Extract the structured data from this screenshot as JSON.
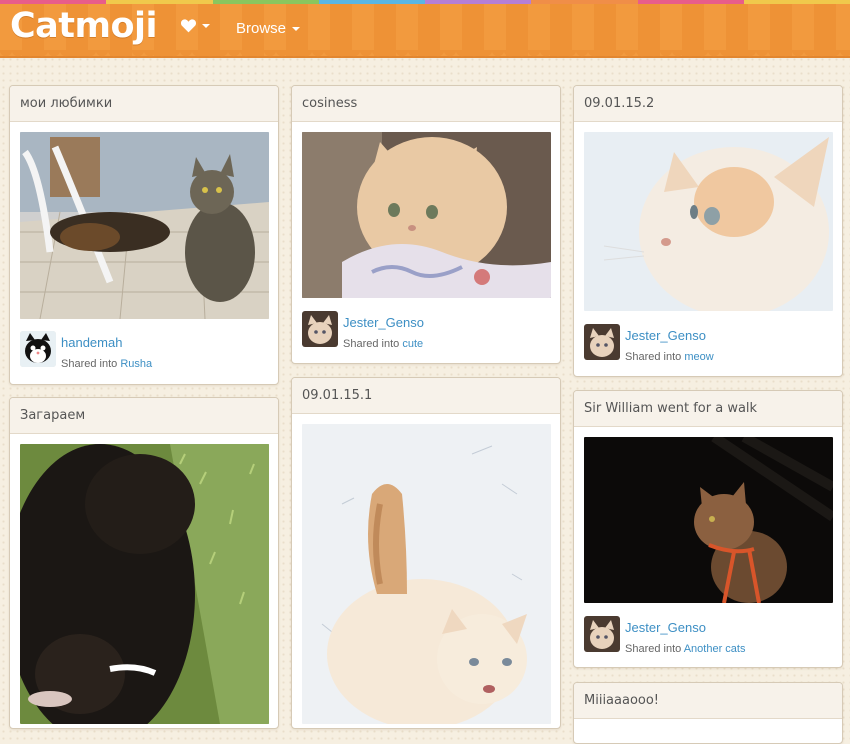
{
  "app": {
    "logo": "Catmoji",
    "nav": {
      "browse_label": "Browse"
    },
    "colors": {
      "header": "#f29a3e",
      "link": "#3d8fc4",
      "rainbow": [
        "#e85d8a",
        "#f0c94c",
        "#8ac65e",
        "#5ab6e3",
        "#b57fd6",
        "#f08e48",
        "#e85d8a",
        "#f0c94c"
      ]
    }
  },
  "cards": [
    {
      "title": "мои любимки",
      "user": "handemah",
      "shared_prefix": "Shared into",
      "collection": "Rusha",
      "avatar_icon": "cat-face-icon"
    },
    {
      "title": "Загараем"
    },
    {
      "title": "cosiness",
      "user": "Jester_Genso",
      "shared_prefix": "Shared into",
      "collection": "cute",
      "avatar_icon": "cat-photo-avatar"
    },
    {
      "title": "09.01.15.1"
    },
    {
      "title": "09.01.15.2",
      "user": "Jester_Genso",
      "shared_prefix": "Shared into",
      "collection": "meow",
      "avatar_icon": "cat-photo-avatar"
    },
    {
      "title": "Sir William went for a walk",
      "user": "Jester_Genso",
      "shared_prefix": "Shared into",
      "collection": "Another cats",
      "avatar_icon": "cat-photo-avatar"
    },
    {
      "title": "Miiiaaaooo!"
    }
  ]
}
